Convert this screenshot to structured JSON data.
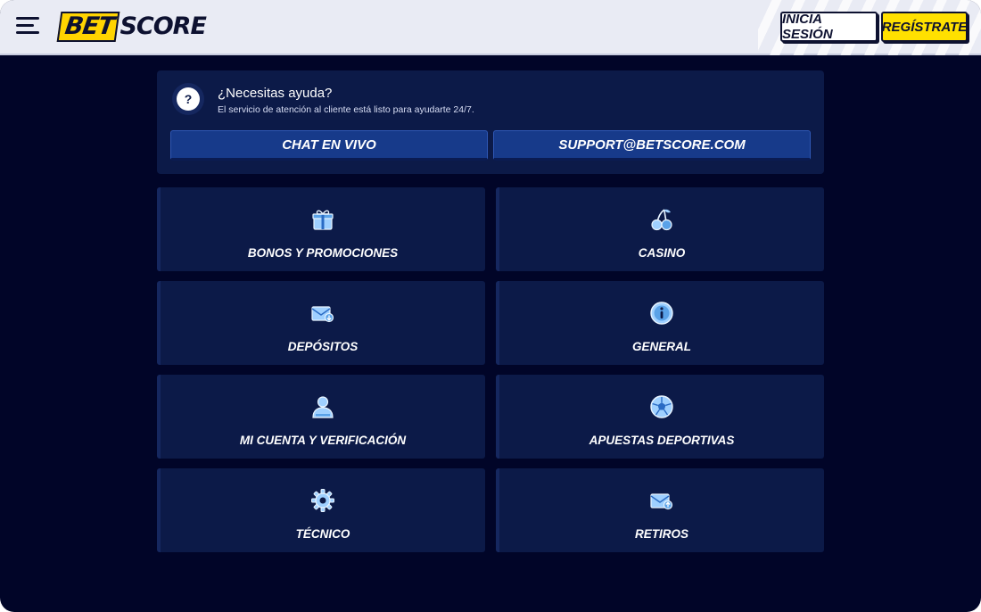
{
  "header": {
    "logo_part1": "BET",
    "logo_part2": "SCORE",
    "login_label": "INICIA SESIÓN",
    "register_label": "REGÍSTRATE"
  },
  "help": {
    "icon": "?",
    "title": "¿Necesitas ayuda?",
    "subtitle": "El servicio de atención al cliente está listo para ayudarte 24/7.",
    "chat_label": "CHAT EN VIVO",
    "email_label": "SUPPORT@BETSCORE.COM"
  },
  "categories": [
    {
      "label": "BONOS Y PROMOCIONES",
      "icon": "gift-icon"
    },
    {
      "label": "CASINO",
      "icon": "cherries-icon"
    },
    {
      "label": "DEPÓSITOS",
      "icon": "wallet-in-icon"
    },
    {
      "label": "GENERAL",
      "icon": "info-icon"
    },
    {
      "label": "MI CUENTA Y VERIFICACIÓN",
      "icon": "user-icon"
    },
    {
      "label": "APUESTAS DEPORTIVAS",
      "icon": "soccer-ball-icon"
    },
    {
      "label": "TÉCNICO",
      "icon": "gear-icon"
    },
    {
      "label": "RETIROS",
      "icon": "wallet-out-icon"
    }
  ],
  "colors": {
    "background": "#010528",
    "card": "#0c1a48",
    "button": "#173a8a",
    "accent_yellow": "#ffe000",
    "icon_light": "#9fd0ff"
  }
}
